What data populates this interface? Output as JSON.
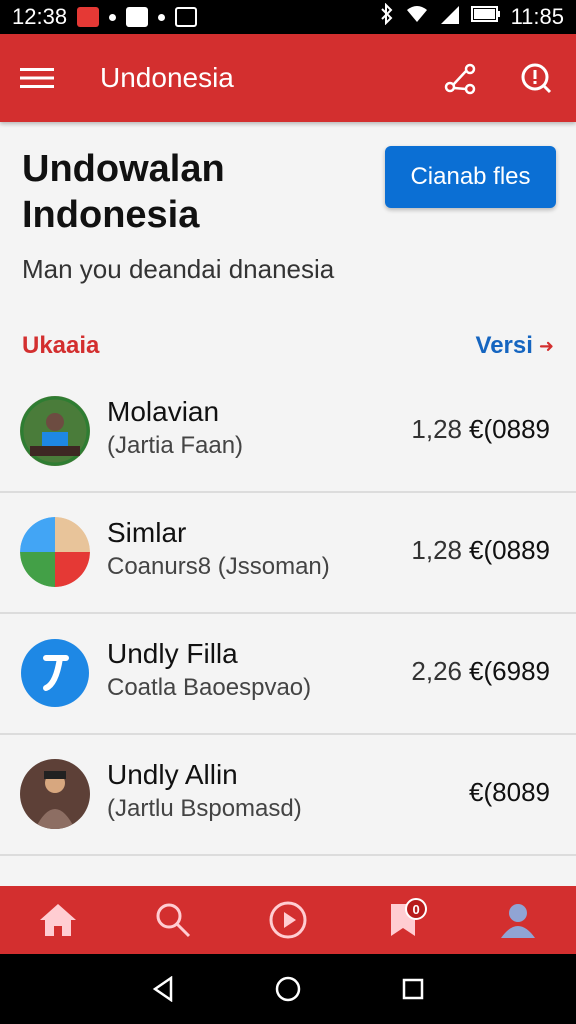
{
  "status_bar": {
    "time": "12:38",
    "right_time": "11:85",
    "icons": [
      "notification-icon",
      "photo-icon",
      "image-icon",
      "bluetooth-icon",
      "wifi-icon",
      "signal-icon",
      "battery-icon"
    ]
  },
  "app_bar": {
    "title": "Undonesia",
    "icons": [
      "menu-icon",
      "share-icon",
      "info-icon"
    ]
  },
  "header": {
    "title": "Undowalan Indonesia",
    "action_button": "Cianab fles",
    "subtitle": "Man you deandai dnanesia"
  },
  "section": {
    "label": "Ukaaia",
    "link": "Versi",
    "link_icon": "arrow-right-icon"
  },
  "list": [
    {
      "name": "Molavian",
      "sub": "(Jartia Faan)",
      "num": "1,28",
      "value": "€(0889",
      "avatar": "person-photo"
    },
    {
      "name": "Simlar",
      "sub": "Coanurs8 (Jssoman)",
      "num": "1,28",
      "value": "€(0889",
      "avatar": "app-icon-colorful"
    },
    {
      "name": "Undly Filla",
      "sub": "Coatla Baoespvao)",
      "num": "2,26",
      "value": "€(6989",
      "avatar": "app-icon-blue"
    },
    {
      "name": "Undly Allin",
      "sub": "(Jartlu Bspomasd)",
      "num": "",
      "value": "€(8089",
      "avatar": "person-photo"
    }
  ],
  "bottom_nav": {
    "items": [
      "home-icon",
      "search-icon",
      "play-icon",
      "bookmark-icon",
      "profile-icon"
    ],
    "bookmark_badge": "0"
  },
  "colors": {
    "primary": "#d32f2f",
    "button": "#0b6fd4",
    "link": "#1565c0"
  }
}
